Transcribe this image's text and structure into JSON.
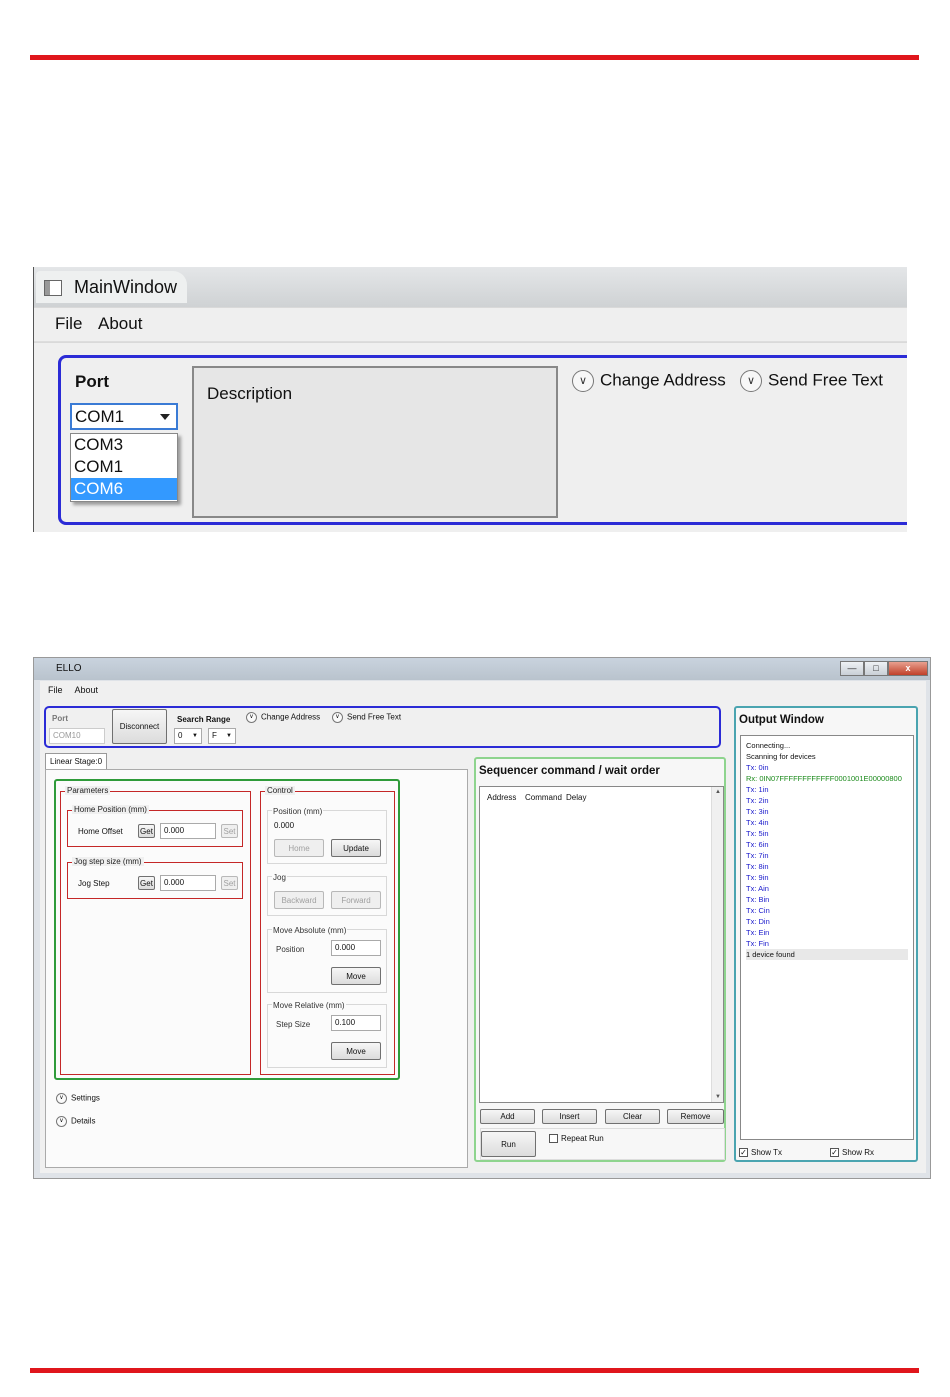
{
  "accent": "#e0161c",
  "window1": {
    "title": "MainWindow",
    "menu": [
      "File",
      "About"
    ],
    "port_label": "Port",
    "combo_value": "COM1",
    "dropdown_items": [
      "COM3",
      "COM1",
      "COM6"
    ],
    "dropdown_selected": "COM6",
    "description_label": "Description",
    "change_address": "Change Address",
    "send_free_text": "Send Free Text"
  },
  "window2": {
    "title": "ELLO",
    "menu": [
      "File",
      "About"
    ],
    "window_buttons": {
      "minimize": "—",
      "maximize": "□",
      "close": "x"
    },
    "top": {
      "port_label": "Port",
      "port_value": "COM10",
      "disconnect": "Disconnect",
      "search_range_label": "Search Range",
      "range_from": "0",
      "range_to": "F",
      "change_address": "Change Address",
      "send_free_text": "Send Free Text"
    },
    "tab": "Linear Stage:0",
    "parameters": {
      "label": "Parameters",
      "home_position": {
        "label": "Home Position (mm)",
        "field_label": "Home Offset",
        "get": "Get",
        "value": "0.000",
        "set": "Set"
      },
      "jog_step_size": {
        "label": "Jog step size (mm)",
        "field_label": "Jog Step",
        "get": "Get",
        "value": "0.000",
        "set": "Set"
      }
    },
    "control": {
      "label": "Control",
      "position": {
        "label": "Position (mm)",
        "value": "0.000",
        "home": "Home",
        "update": "Update"
      },
      "jog": {
        "label": "Jog",
        "backward": "Backward",
        "forward": "Forward"
      },
      "move_absolute": {
        "label": "Move Absolute (mm)",
        "field_label": "Position",
        "value": "0.000",
        "move": "Move"
      },
      "move_relative": {
        "label": "Move Relative (mm)",
        "field_label": "Step Size",
        "value": "0.100",
        "move": "Move"
      }
    },
    "expanders": {
      "settings": "Settings",
      "details": "Details"
    },
    "sequencer": {
      "title": "Sequencer command / wait order",
      "columns": [
        "Address",
        "Command",
        "Delay"
      ],
      "add": "Add",
      "insert": "Insert",
      "clear": "Clear",
      "remove": "Remove",
      "run": "Run",
      "repeat_run": "Repeat Run"
    },
    "output": {
      "title": "Output Window",
      "lines": [
        {
          "text": "Connecting...",
          "kind": "info"
        },
        {
          "text": "Scanning for devices",
          "kind": "info"
        },
        {
          "text": "Tx: 0in",
          "kind": "tx"
        },
        {
          "text": "Rx: 0IN07FFFFFFFFFFFF0001001E00000800",
          "kind": "rx"
        },
        {
          "text": "Tx: 1in",
          "kind": "tx"
        },
        {
          "text": "Tx: 2in",
          "kind": "tx"
        },
        {
          "text": "Tx: 3in",
          "kind": "tx"
        },
        {
          "text": "Tx: 4in",
          "kind": "tx"
        },
        {
          "text": "Tx: 5in",
          "kind": "tx"
        },
        {
          "text": "Tx: 6in",
          "kind": "tx"
        },
        {
          "text": "Tx: 7in",
          "kind": "tx"
        },
        {
          "text": "Tx: 8in",
          "kind": "tx"
        },
        {
          "text": "Tx: 9in",
          "kind": "tx"
        },
        {
          "text": "Tx: Ain",
          "kind": "tx"
        },
        {
          "text": "Tx: Bin",
          "kind": "tx"
        },
        {
          "text": "Tx: Cin",
          "kind": "tx"
        },
        {
          "text": "Tx: Din",
          "kind": "tx"
        },
        {
          "text": "Tx: Ein",
          "kind": "tx"
        },
        {
          "text": "Tx: Fin",
          "kind": "tx"
        },
        {
          "text": "1 device found",
          "kind": "highlight"
        }
      ],
      "colors": {
        "info": "#111111",
        "tx": "#1a1acc",
        "rx": "#1b8a1b",
        "highlight": "#111111"
      },
      "show_tx": "Show Tx",
      "show_rx": "Show Rx"
    }
  }
}
